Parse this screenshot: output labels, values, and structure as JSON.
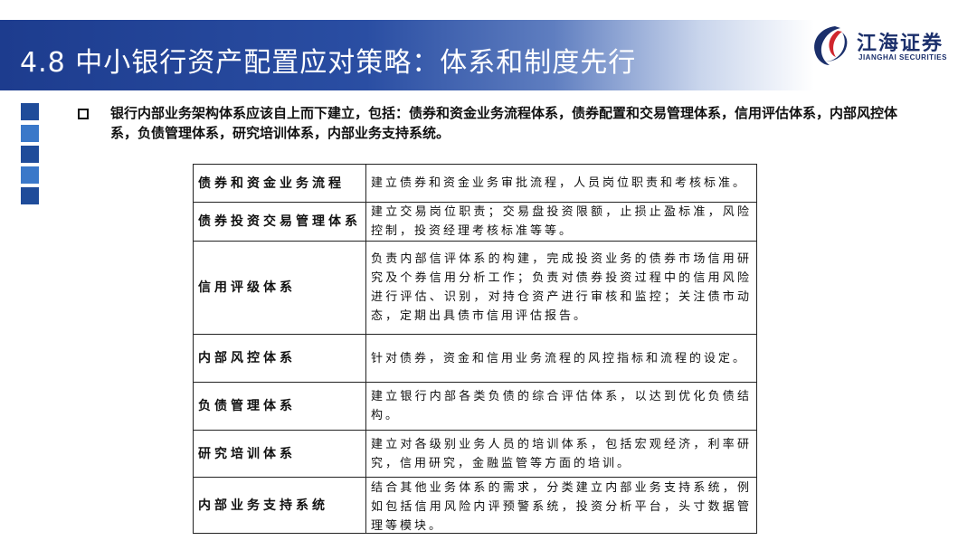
{
  "header": {
    "title": "4.8 中小银行资产配置应对策略：体系和制度先行"
  },
  "logo": {
    "name_cn": "江海证券",
    "name_en": "JIANGHAI SECURITIES",
    "icon": "jianghai-logo-icon"
  },
  "colors": {
    "title_band": "#1d3c8e",
    "accent": "#3a78c9",
    "logo_text": "#1b2f6b"
  },
  "intro": {
    "text": "银行内部业务架构体系应该自上而下建立，包括：债券和资金业务流程体系，债券配置和交易管理体系，信用评估体系，内部风控体系，负债管理体系，研究培训体系，内部业务支持系统。"
  },
  "table": {
    "rows": [
      {
        "name": "债券和资金业务流程",
        "desc": "建立债券和资金业务审批流程，人员岗位职责和考核标准。"
      },
      {
        "name": "债券投资交易管理体系",
        "desc": "建立交易岗位职责；交易盘投资限额，止损止盈标准，风险控制，投资经理考核标准等等。"
      },
      {
        "name": "信用评级体系",
        "desc": "负责内部信评体系的构建，完成投资业务的债券市场信用研究及个券信用分析工作；负责对债券投资过程中的信用风险进行评估、识别，对持仓资产进行审核和监控；关注债市动态，定期出具债市信用评估报告。"
      },
      {
        "name": "内部风控体系",
        "desc": "针对债券，资金和信用业务流程的风控指标和流程的设定。"
      },
      {
        "name": "负债管理体系",
        "desc": "建立银行内部各类负债的综合评估体系，以达到优化负债结构。"
      },
      {
        "name": "研究培训体系",
        "desc": "建立对各级别业务人员的培训体系，包括宏观经济，利率研究，信用研究，金融监管等方面的培训。"
      },
      {
        "name": "内部业务支持系统",
        "desc": "结合其他业务体系的需求，分类建立内部业务支持系统，例如包括信用风险内评预警系统，投资分析平台，头寸数据管理等模块。"
      }
    ]
  }
}
